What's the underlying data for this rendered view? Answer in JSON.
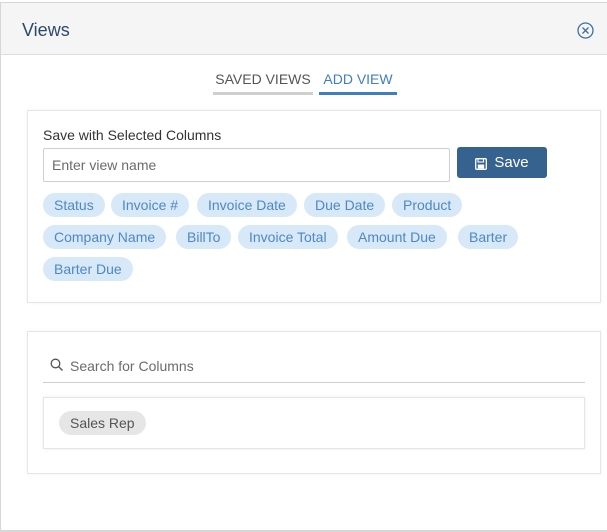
{
  "header": {
    "title": "Views"
  },
  "tabs": [
    {
      "label": "SAVED VIEWS",
      "active": false
    },
    {
      "label": "ADD VIEW",
      "active": true
    }
  ],
  "add_view": {
    "section_label": "Save with Selected Columns",
    "name_input": {
      "placeholder": "Enter view name",
      "value": ""
    },
    "save_label": "Save",
    "selected_columns": [
      "Status",
      "Invoice #",
      "Invoice Date",
      "Due Date",
      "Product",
      "Company Name",
      "BillTo",
      "Invoice Total",
      "Amount Due",
      "Barter",
      "Barter Due"
    ]
  },
  "column_search": {
    "placeholder": "Search for Columns",
    "value": "",
    "available_columns": [
      "Sales Rep"
    ]
  },
  "colors": {
    "accent": "#3d7fc1",
    "button": "#35628f",
    "chip_selected_bg": "#d7e8f8",
    "chip_available_bg": "#e6e6e6"
  }
}
